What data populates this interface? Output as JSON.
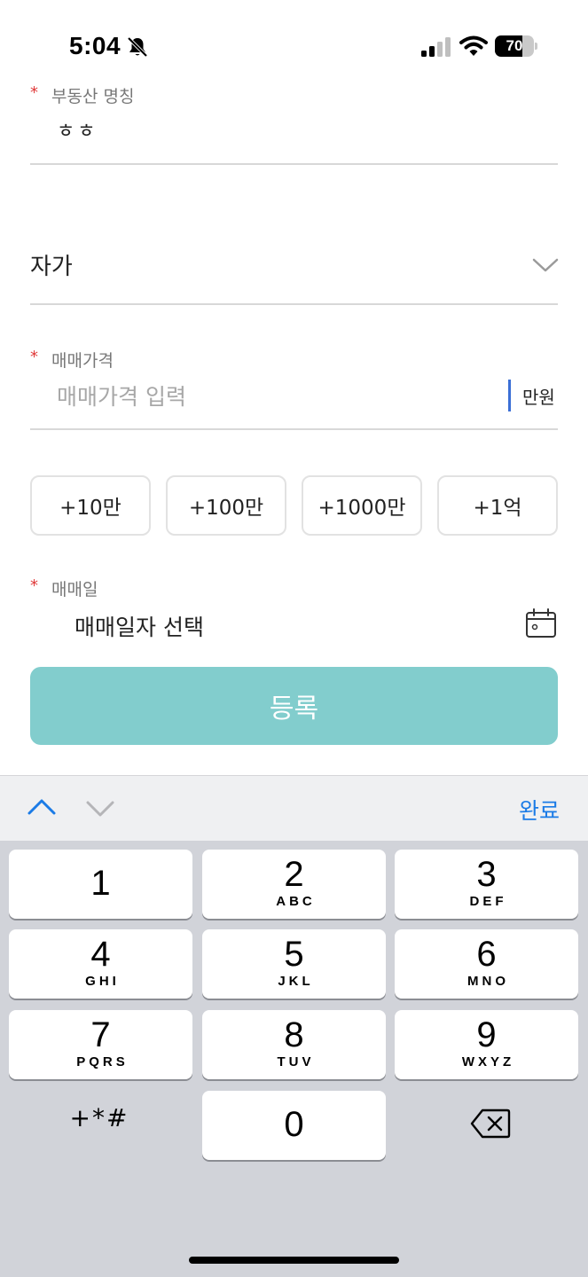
{
  "status_bar": {
    "time": "5:04",
    "battery_level": "70",
    "battery_fraction": 0.7
  },
  "form": {
    "property_name": {
      "label": "부동산 명칭",
      "value": "ㅎㅎ"
    },
    "ownership_select": {
      "value": "자가"
    },
    "price": {
      "label": "매매가격",
      "placeholder": "매매가격 입력",
      "unit": "만원"
    },
    "quick_add": [
      "+10만",
      "+100만",
      "+1000만",
      "+1억"
    ],
    "trade_date": {
      "label": "매매일",
      "placeholder": "매매일자 선택"
    },
    "required_mark": "*",
    "submit_label": "등록"
  },
  "keyboard": {
    "done_label": "완료",
    "keys": [
      {
        "digit": "1",
        "letters": ""
      },
      {
        "digit": "2",
        "letters": "ABC"
      },
      {
        "digit": "3",
        "letters": "DEF"
      },
      {
        "digit": "4",
        "letters": "GHI"
      },
      {
        "digit": "5",
        "letters": "JKL"
      },
      {
        "digit": "6",
        "letters": "MNO"
      },
      {
        "digit": "7",
        "letters": "PQRS"
      },
      {
        "digit": "8",
        "letters": "TUV"
      },
      {
        "digit": "9",
        "letters": "WXYZ"
      },
      {
        "digit": "0",
        "letters": ""
      }
    ],
    "symbols_label": "+*#"
  },
  "colors": {
    "accent_button": "#82cdcd",
    "link_blue": "#1b7be6",
    "required_red": "#e03a3a",
    "cursor_blue": "#3b6fd6"
  }
}
